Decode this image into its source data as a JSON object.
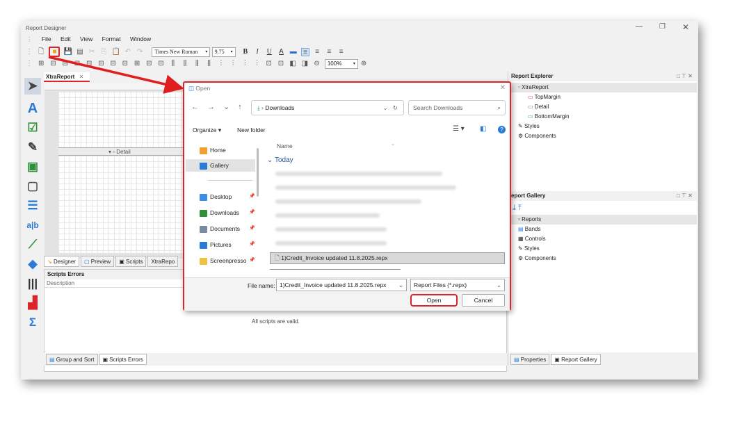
{
  "app": {
    "title": "Report Designer"
  },
  "menu": [
    "File",
    "Edit",
    "View",
    "Format",
    "Window"
  ],
  "toolbar": {
    "font_name": "Times New Roman",
    "font_size": "9.75",
    "bold": "B",
    "italic": "I",
    "underline": "U",
    "zoom": "100%"
  },
  "tabs": {
    "document": "XtraReport",
    "designer": "Designer",
    "preview": "Preview",
    "scripts": "Scripts",
    "xtrarep": "XtraRepo"
  },
  "band": {
    "detail": "Detail"
  },
  "scripts_errors": {
    "title": "Scripts Errors",
    "col_description": "Description",
    "message": "All scripts are valid."
  },
  "bottom_tabs": {
    "group_sort": "Group and Sort",
    "scripts_errors": "Scripts Errors",
    "properties": "Properties",
    "report_gallery": "Report Gallery"
  },
  "report_explorer": {
    "title": "Report Explorer",
    "items": [
      "XtraReport",
      "TopMargin",
      "Detail",
      "BottomMargin",
      "Styles",
      "Components"
    ]
  },
  "report_gallery": {
    "title": "eport Gallery",
    "items": [
      "Reports",
      "Bands",
      "Controls",
      "Styles",
      "Components"
    ]
  },
  "dialog": {
    "title": "Open",
    "path": "Downloads",
    "search_placeholder": "Search Downloads",
    "organize": "Organize",
    "new_folder": "New folder",
    "nav": [
      "Home",
      "Gallery",
      "Desktop",
      "Downloads",
      "Documents",
      "Pictures",
      "Screenpresso"
    ],
    "col_name": "Name",
    "group_today": "Today",
    "selected_file": "1)Credit_Invoice updated 11.8.2025.repx",
    "file_name_label": "File name:",
    "file_name_value": "1)Credit_Invoice updated 11.8.2025.repx",
    "file_type": "Report Files (*.repx)",
    "open": "Open",
    "cancel": "Cancel"
  },
  "colors": {
    "accent": "#0078d4",
    "highlight": "#d9262b",
    "window_bg": "#f1f1f1"
  }
}
